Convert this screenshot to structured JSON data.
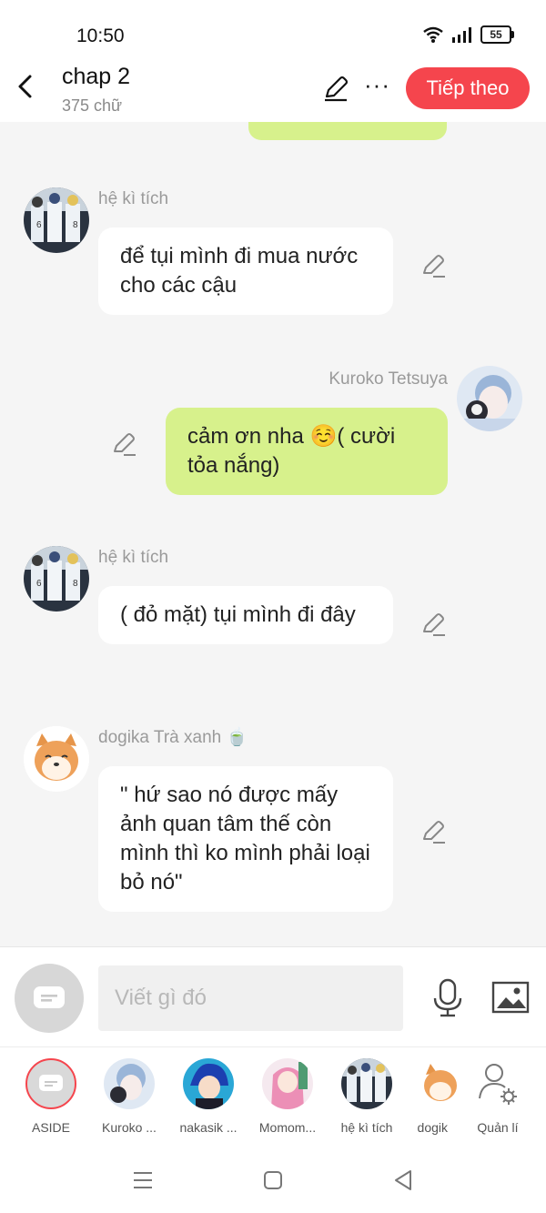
{
  "status": {
    "time": "10:50",
    "battery": "55"
  },
  "header": {
    "title": "chap 2",
    "word_count": "375 chữ",
    "next_label": "Tiếp theo",
    "more": "···"
  },
  "messages": [
    {
      "sender": "hệ kì tích",
      "text": "để tụi mình đi mua nước cho các cậu",
      "side": "left"
    },
    {
      "sender": "Kuroko Tetsuya",
      "text": "cảm ơn nha ☺️( cười tỏa nắng)",
      "side": "right"
    },
    {
      "sender": "hệ kì tích",
      "text": "( đỏ mặt) tụi mình đi đây",
      "side": "left"
    },
    {
      "sender": "dogika Trà xanh 🍵",
      "text": "\" hứ sao nó được mấy ảnh quan tâm thế còn mình thì ko mình phải loại bỏ nó\"",
      "side": "left"
    }
  ],
  "composer": {
    "placeholder": "Viết gì đó"
  },
  "characters": [
    {
      "label": "ASIDE"
    },
    {
      "label": "Kuroko ..."
    },
    {
      "label": "nakasik ..."
    },
    {
      "label": "Momom..."
    },
    {
      "label": "hệ kì tích"
    },
    {
      "label": "dogik"
    },
    {
      "label": "Quản lí"
    }
  ],
  "colors": {
    "accent": "#f5454d",
    "bubble_me": "#d7f18c",
    "bubble_other": "#ffffff",
    "background": "#f5f5f5"
  }
}
